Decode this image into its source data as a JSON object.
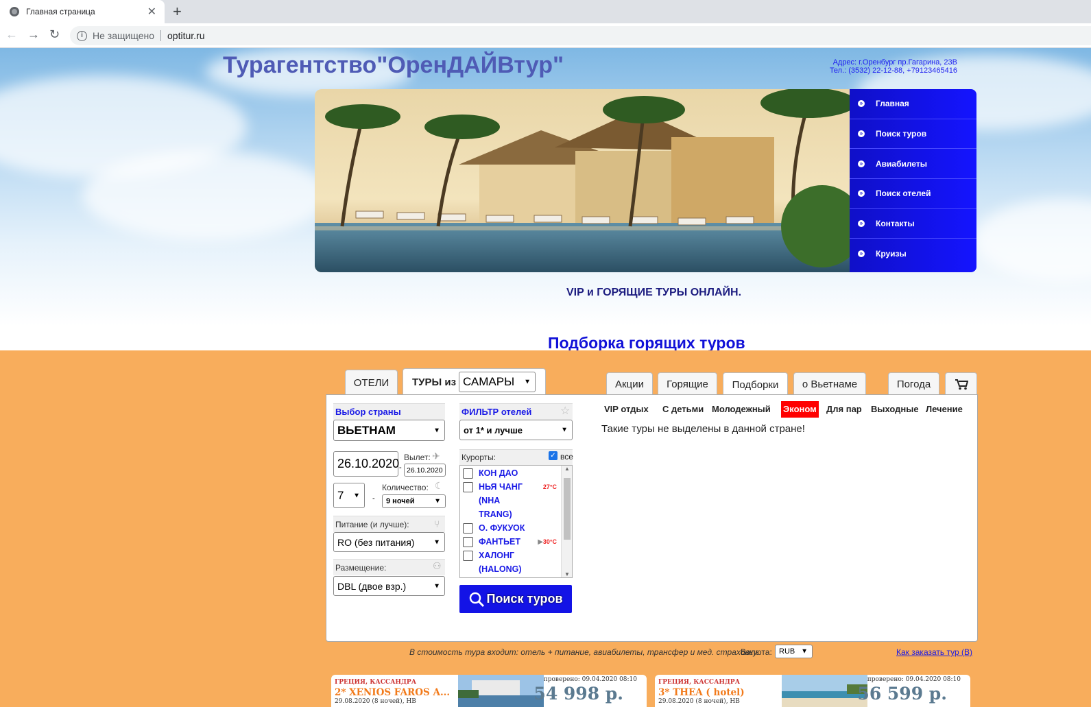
{
  "browser": {
    "tab_title": "Главная страница",
    "insecure_label": "Не защищено",
    "url": "optitur.ru"
  },
  "header": {
    "title": "Турагентство\"ОренДАЙВтур\"",
    "address": "Адрес: г.Оренбург пр.Гагарина, 23В",
    "phone": "Тел.: (3532) 22-12-88, +79123465416"
  },
  "menu": {
    "items": [
      "Главная",
      "Поиск туров",
      "Авиабилеты",
      "Поиск отелей",
      "Контакты",
      "Круизы"
    ]
  },
  "vip_line": "VIP и ГОРЯЩИЕ ТУРЫ ОНЛАЙН.",
  "hot_title": "Подборка горящих туров",
  "search_tabs": {
    "hotels": "ОТЕЛИ",
    "tours_from": "ТУРЫ из",
    "departure_city": "САМАРЫ"
  },
  "form": {
    "country_label": "Выбор страны",
    "country_value": "ВЬЕТНАМ",
    "date_value": "26.10.2020",
    "departure_label": "Вылет:",
    "departure_date": "26.10.2020",
    "nights_from": "7",
    "count_label": "Количество:",
    "nights_to": "9 ночей",
    "meal_label": "Питание (и лучше):",
    "meal_value": "RO (без питания)",
    "room_label": "Размещение:",
    "room_value": "DBL (двое взр.)",
    "filter_label": "ФИЛЬТР отелей",
    "filter_value": "от 1* и лучше",
    "resorts_label": "Курорты:",
    "all_label": "все",
    "search_button": "Поиск туров"
  },
  "resorts": [
    {
      "name": "КОН ДАО",
      "temp": ""
    },
    {
      "name": "НЬЯ ЧАНГ (NHA TRANG)",
      "temp": "27°C"
    },
    {
      "name": "О. ФУКУОК",
      "temp": ""
    },
    {
      "name": "ФАНТЬЕТ",
      "temp": "30°C"
    },
    {
      "name": "ХАЛОНГ (HALONG)",
      "temp": ""
    }
  ],
  "right_tabs": [
    "Акции",
    "Горящие",
    "Подборки",
    "о Вьетнаме",
    "Погода"
  ],
  "subcategories": [
    "VIP отдых",
    "С детьми",
    "Молодежный",
    "Эконом",
    "Для пар",
    "Выходные",
    "Лечение"
  ],
  "empty_message": "Такие туры не выделены в данной стране!",
  "footer": {
    "note": "В стоимость тура входит: отель + питание, авиабилеты, трансфер и мед. страховку.",
    "currency_label": "Валюта:",
    "currency_value": "RUB",
    "howto_link": "Как заказать тур (В)"
  },
  "offers": [
    {
      "location": "ГРЕЦИЯ, КАССАНДРА",
      "hotel": "2* XENIOS FAROS A...",
      "dates": "29.08.2020 (8 ночей), НВ",
      "checked": "проверено: 09.04.2020 08:10",
      "price": "54 998 р."
    },
    {
      "location": "ГРЕЦИЯ, КАССАНДРА",
      "hotel": "3* THEA ( hotel)",
      "dates": "29.08.2020 (8 ночей), НВ",
      "checked": "проверено: 09.04.2020 08:10",
      "price": "56 599 р."
    }
  ],
  "colors": {
    "accent_blue": "#1414ff",
    "orange_bg": "#f8ad5c",
    "highlight_red": "#ff0000"
  }
}
